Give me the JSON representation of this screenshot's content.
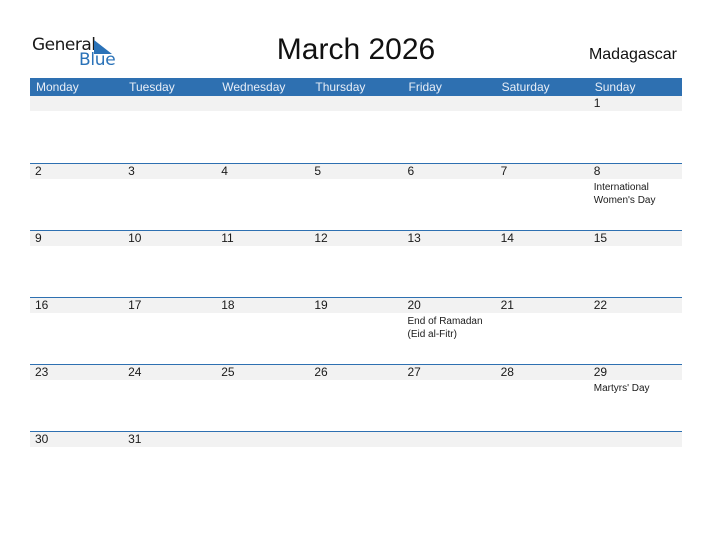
{
  "logo": {
    "general": "General",
    "blue": "Blue",
    "icon": "triangle-flag-icon"
  },
  "title": "March 2026",
  "country": "Madagascar",
  "colors": {
    "accent": "#2e70b1",
    "band": "#f2f2f2"
  },
  "weekdays": [
    "Monday",
    "Tuesday",
    "Wednesday",
    "Thursday",
    "Friday",
    "Saturday",
    "Sunday"
  ],
  "weeks": [
    {
      "days": [
        {
          "n": "",
          "e": ""
        },
        {
          "n": "",
          "e": ""
        },
        {
          "n": "",
          "e": ""
        },
        {
          "n": "",
          "e": ""
        },
        {
          "n": "",
          "e": ""
        },
        {
          "n": "",
          "e": ""
        },
        {
          "n": "1",
          "e": ""
        }
      ]
    },
    {
      "days": [
        {
          "n": "2",
          "e": ""
        },
        {
          "n": "3",
          "e": ""
        },
        {
          "n": "4",
          "e": ""
        },
        {
          "n": "5",
          "e": ""
        },
        {
          "n": "6",
          "e": ""
        },
        {
          "n": "7",
          "e": ""
        },
        {
          "n": "8",
          "e": "International Women's Day"
        }
      ]
    },
    {
      "days": [
        {
          "n": "9",
          "e": ""
        },
        {
          "n": "10",
          "e": ""
        },
        {
          "n": "11",
          "e": ""
        },
        {
          "n": "12",
          "e": ""
        },
        {
          "n": "13",
          "e": ""
        },
        {
          "n": "14",
          "e": ""
        },
        {
          "n": "15",
          "e": ""
        }
      ]
    },
    {
      "days": [
        {
          "n": "16",
          "e": ""
        },
        {
          "n": "17",
          "e": ""
        },
        {
          "n": "18",
          "e": ""
        },
        {
          "n": "19",
          "e": ""
        },
        {
          "n": "20",
          "e": "End of Ramadan (Eid al-Fitr)"
        },
        {
          "n": "21",
          "e": ""
        },
        {
          "n": "22",
          "e": ""
        }
      ]
    },
    {
      "days": [
        {
          "n": "23",
          "e": ""
        },
        {
          "n": "24",
          "e": ""
        },
        {
          "n": "25",
          "e": ""
        },
        {
          "n": "26",
          "e": ""
        },
        {
          "n": "27",
          "e": ""
        },
        {
          "n": "28",
          "e": ""
        },
        {
          "n": "29",
          "e": "Martyrs' Day"
        }
      ]
    },
    {
      "days": [
        {
          "n": "30",
          "e": ""
        },
        {
          "n": "31",
          "e": ""
        },
        {
          "n": "",
          "e": ""
        },
        {
          "n": "",
          "e": ""
        },
        {
          "n": "",
          "e": ""
        },
        {
          "n": "",
          "e": ""
        },
        {
          "n": "",
          "e": ""
        }
      ]
    }
  ]
}
